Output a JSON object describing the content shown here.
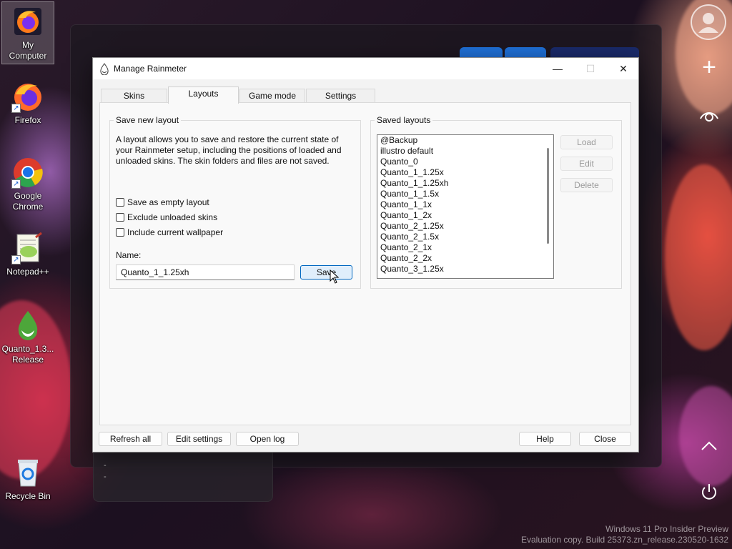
{
  "desktop": {
    "icons": [
      {
        "label": "My Computer",
        "kind": "firefox",
        "selected": true
      },
      {
        "label": "Firefox",
        "kind": "firefox",
        "shortcut": true
      },
      {
        "label": "Google Chrome",
        "kind": "chrome",
        "shortcut": true
      },
      {
        "label": "Notepad++",
        "kind": "notepadpp",
        "shortcut": true
      },
      {
        "label": "Quanto_1.3... Release",
        "kind": "rainmeter-drop"
      },
      {
        "label": "Recycle Bin",
        "kind": "recycle-bin"
      }
    ],
    "bg_lower_text": [
      "-",
      "-"
    ],
    "watermark": {
      "line1": "Windows 11 Pro Insider Preview",
      "line2": "Evaluation copy. Build 25373.zn_release.230520-1632"
    }
  },
  "dialog": {
    "title": "Manage Rainmeter",
    "title_icon": "rainmeter-drop-icon",
    "window_buttons": {
      "minimize": "—",
      "maximize": "☐",
      "close": "✕"
    },
    "tabs": [
      "Skins",
      "Layouts",
      "Game mode",
      "Settings"
    ],
    "active_tab": "Layouts",
    "save_group": {
      "legend": "Save new layout",
      "description": "A layout allows you to save and restore the current state of your Rainmeter setup, including the positions of loaded and unloaded skins. The skin folders and files are not saved.",
      "checkboxes": [
        {
          "label": "Save as empty layout",
          "checked": false
        },
        {
          "label": "Exclude unloaded skins",
          "checked": false
        },
        {
          "label": "Include current wallpaper",
          "checked": false
        }
      ],
      "name_label": "Name:",
      "name_value": "Quanto_1_1.25xh",
      "save_button": "Save"
    },
    "saved_group": {
      "legend": "Saved layouts",
      "items": [
        "@Backup",
        "illustro default",
        "Quanto_0",
        "Quanto_1_1.25x",
        "Quanto_1_1.25xh",
        "Quanto_1_1.5x",
        "Quanto_1_1x",
        "Quanto_1_2x",
        "Quanto_2_1.25x",
        "Quanto_2_1.5x",
        "Quanto_2_1x",
        "Quanto_2_2x",
        "Quanto_3_1.25x"
      ],
      "buttons": {
        "load": "Load",
        "edit": "Edit",
        "delete": "Delete"
      }
    },
    "footer": {
      "refresh_all": "Refresh all",
      "edit_settings": "Edit settings",
      "open_log": "Open log",
      "help": "Help",
      "close": "Close"
    }
  }
}
